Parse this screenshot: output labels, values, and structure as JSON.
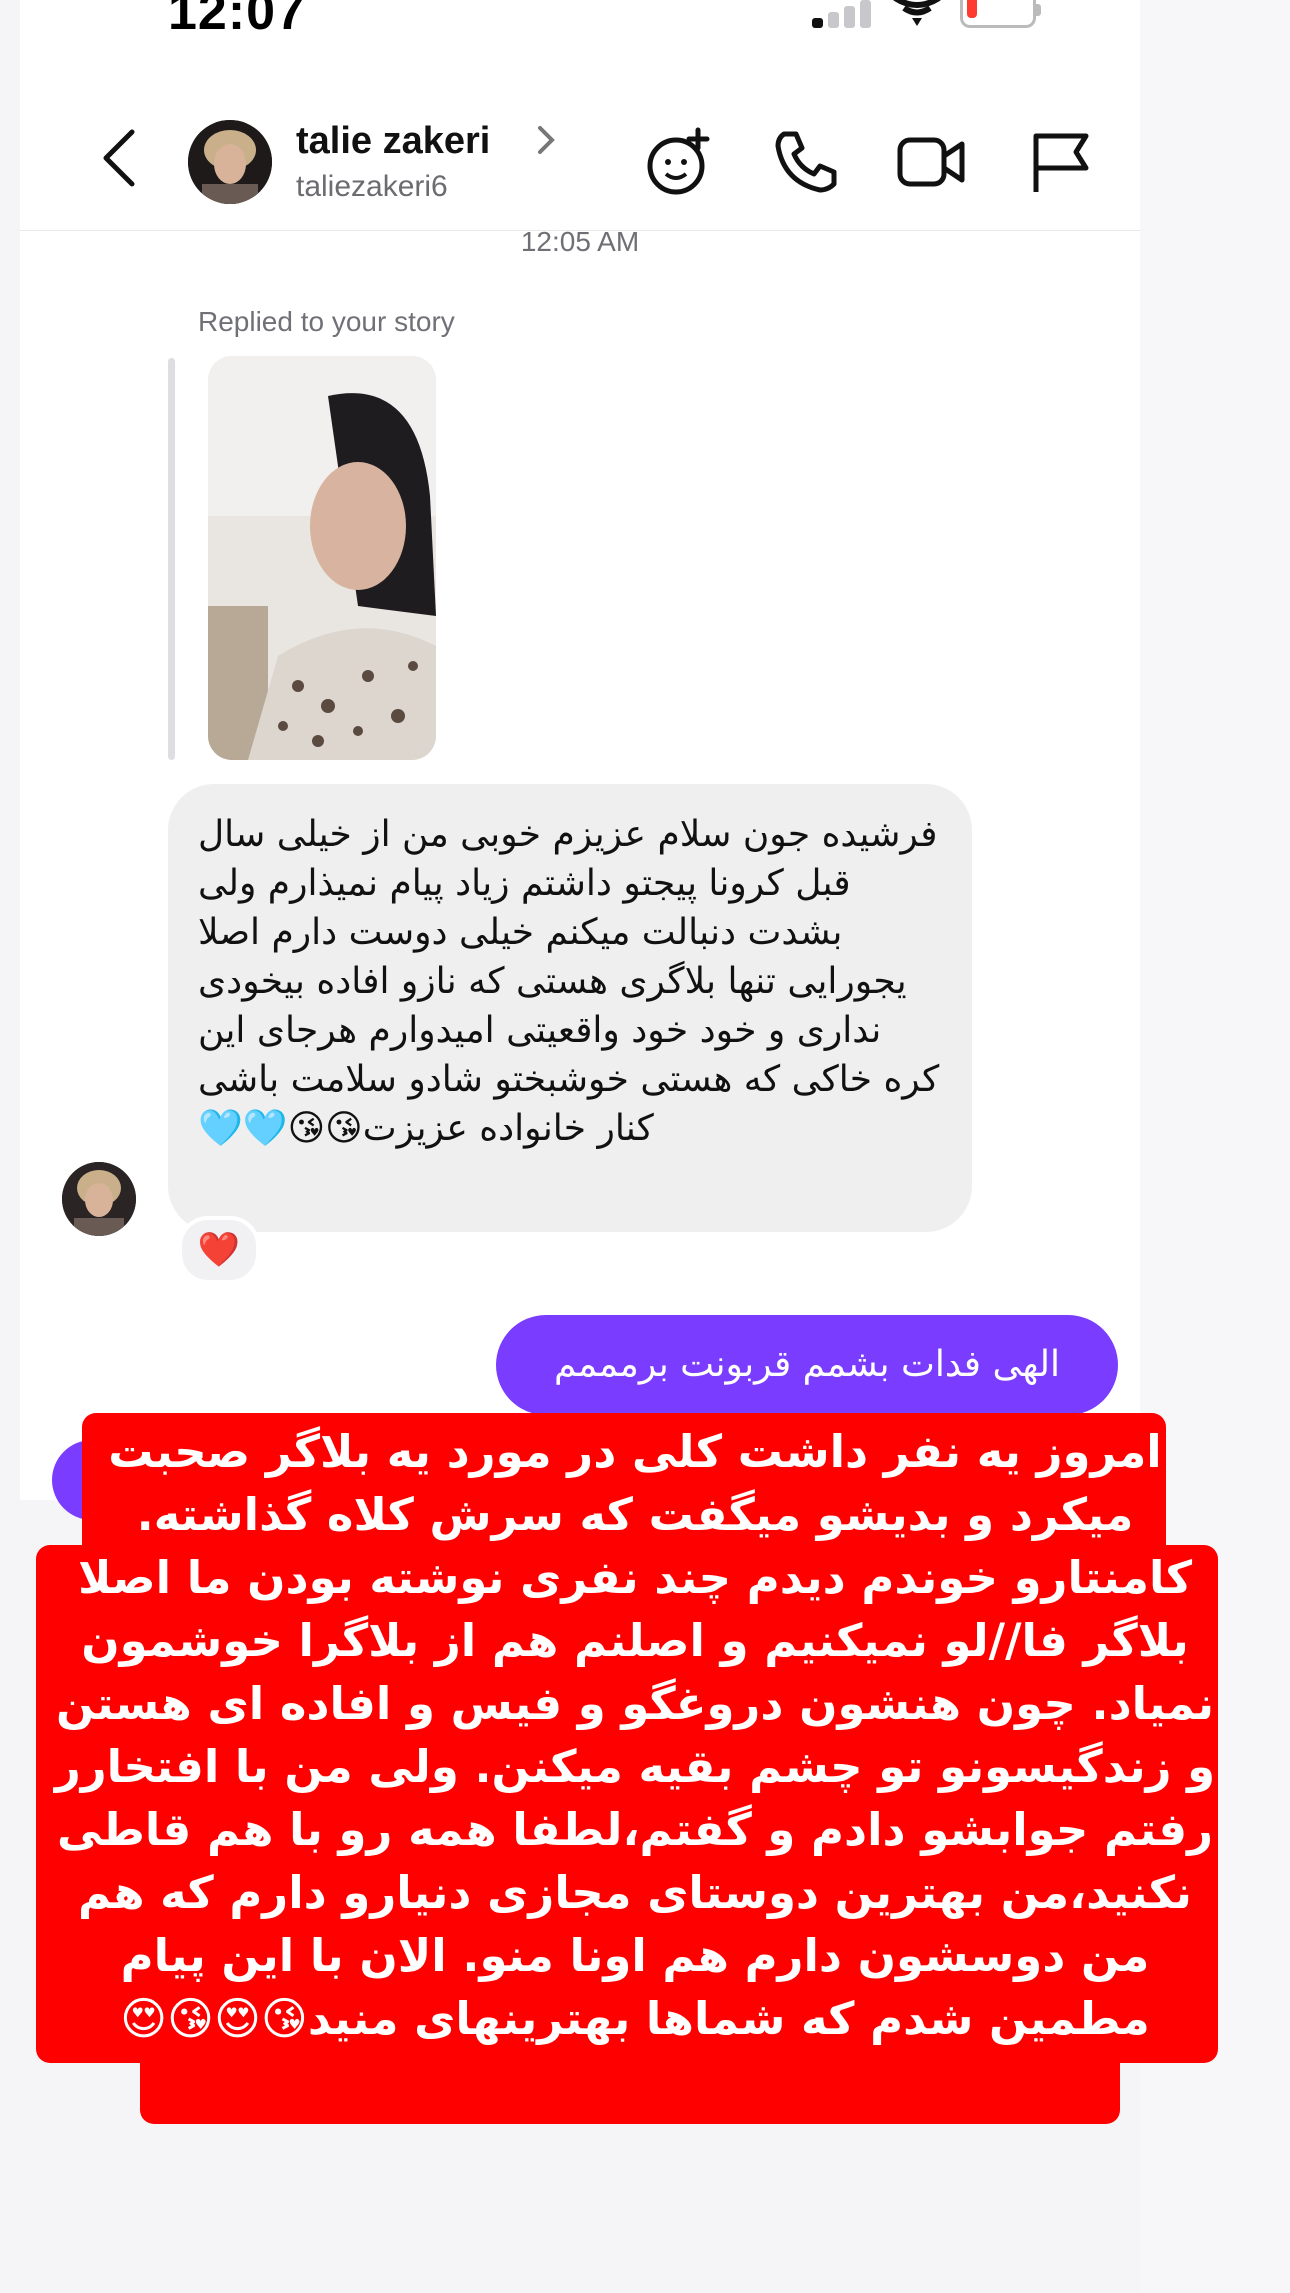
{
  "status_bar": {
    "time": "12:07"
  },
  "header": {
    "name": "talie zakeri",
    "username": "taliezakeri6",
    "icons": [
      "back-icon",
      "avatar-sticker-icon",
      "phone-icon",
      "video-icon",
      "flag-icon"
    ]
  },
  "thread": {
    "timestamp": "12:05 AM",
    "replied_label": "Replied to your story",
    "incoming_message": "فرشیده جون سلام عزیزم خوبی\nمن از خیلی سال قبل کرونا پیجتو داشتم زیاد پیام نمیذارم ولی بشدت دنبالت میکنم خیلی دوست دارم اصلا یجورایی تنها بلاگری هستی که نازو افاده بیخودی نداری و خود خود واقعیتی امیدوارم هرجای این کره خاکی که هستی خوشبختو شادو سلامت باشی کنار خانواده عزیزت😘😘🩵🩵",
    "reaction": "❤️",
    "outgoing_message": "الهی فدات بشمم قربونت برمممم"
  },
  "overlay_text": "امروز یه نفر داشت کلی در مورد یه بلاگر صحبت میکرد و بدیشو میگفت که سرش کلاه گذاشته. کامنتارو خوندم دیدم چند نفری نوشته بودن ما اصلا بلاگر فا//لو نمیکنیم و اصلنم هم از بلاگرا خوشمون نمیاد. چون هنشون دروغگو و فیس و افاده ای هستن و زندگیسونو تو چشم بقیه میکنن. ولی من با افتخارر رفتم جوابشو دادم و گفتم،لطفا همه رو با هم قاطی نکنید،من بهترین دوستای مجازی دنیارو دارم که هم من دوسشون دارم هم اونا منو. الان با این پیام مطمین شدم که شماها بهترینهای منید😘😍😘😍",
  "colors": {
    "accent": "#7a3cff",
    "overlay_red": "#ff0000",
    "incoming_bubble": "#efefef"
  }
}
